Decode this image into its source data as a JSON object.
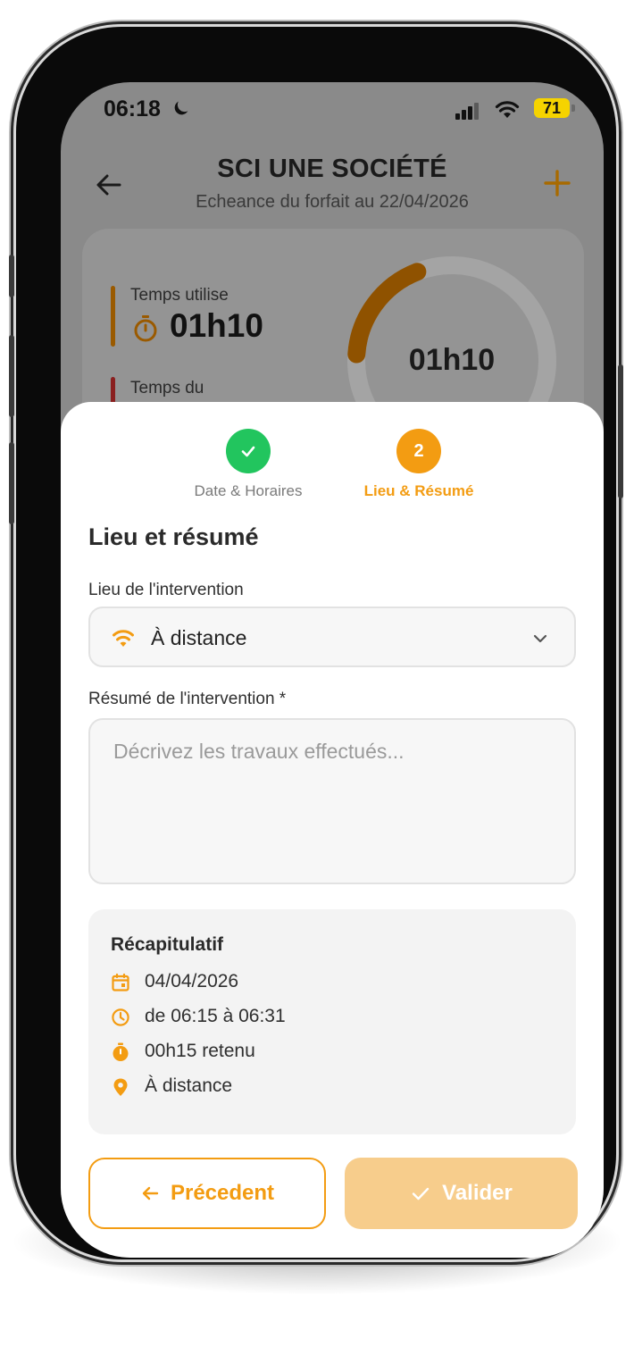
{
  "status_bar": {
    "time": "06:18",
    "battery": "71"
  },
  "header": {
    "title": "SCI UNE SOCIÉTÉ",
    "subtitle": "Echeance du forfait au 22/04/2026"
  },
  "usage_card": {
    "used_label": "Temps utilise",
    "used_value": "01h10",
    "due_label": "Temps du",
    "ring_value": "01h10",
    "ring_fill_fraction": 0.18
  },
  "stepper": {
    "steps": [
      {
        "label": "Date & Horaires",
        "state": "done"
      },
      {
        "label": "Lieu & Résumé",
        "number": "2",
        "state": "active"
      }
    ]
  },
  "form": {
    "section_title": "Lieu et résumé",
    "location_label": "Lieu de l'intervention",
    "location_value": "À distance",
    "summary_label": "Résumé de l'intervention *",
    "summary_placeholder": "Décrivez les travaux effectués...",
    "summary_value": ""
  },
  "recap": {
    "title": "Récapitulatif",
    "date": "04/04/2026",
    "time_range": "de 06:15 à 06:31",
    "duration": "00h15 retenu",
    "location": "À distance"
  },
  "actions": {
    "previous_label": "Précedent",
    "validate_label": "Valider"
  },
  "colors": {
    "accent": "#f39c12",
    "success": "#22c55e",
    "validate_disabled": "#f7cd8c"
  },
  "icons": [
    "moon-icon",
    "signal-icon",
    "wifi-icon",
    "battery-icon",
    "back-arrow-icon",
    "plus-icon",
    "timer-icon",
    "check-icon",
    "wifi-icon",
    "chevron-down-icon",
    "calendar-icon",
    "clock-icon",
    "stopwatch-icon",
    "location-pin-icon",
    "arrow-left-icon",
    "checkmark-icon"
  ]
}
